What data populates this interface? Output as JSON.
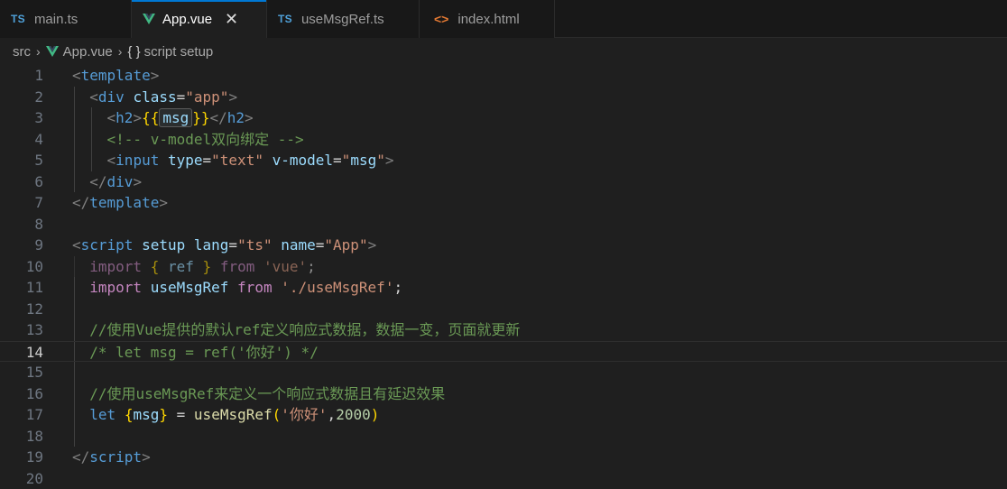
{
  "tabs": [
    {
      "badge": "TS",
      "label": "main.ts"
    },
    {
      "badge": "vue",
      "label": "App.vue",
      "close": "✕"
    },
    {
      "badge": "TS",
      "label": "useMsgRef.ts"
    },
    {
      "badge": "<>",
      "label": "index.html"
    }
  ],
  "breadcrumb": {
    "folder": "src",
    "file": "App.vue",
    "symbol_icon": "{ }",
    "symbol": "script setup"
  },
  "colors": {
    "accent": "#0078d4",
    "vue_green": "#41b883",
    "ts_blue": "#4fa1d9",
    "html_orange": "#e37933"
  },
  "editor": {
    "current_line": 14,
    "lines": [
      {
        "n": "1"
      },
      {
        "n": "2"
      },
      {
        "n": "3"
      },
      {
        "n": "4"
      },
      {
        "n": "5"
      },
      {
        "n": "6"
      },
      {
        "n": "7"
      },
      {
        "n": "8"
      },
      {
        "n": "9"
      },
      {
        "n": "10"
      },
      {
        "n": "11"
      },
      {
        "n": "12"
      },
      {
        "n": "13"
      },
      {
        "n": "14"
      },
      {
        "n": "15"
      },
      {
        "n": "16"
      },
      {
        "n": "17"
      },
      {
        "n": "18"
      },
      {
        "n": "19"
      },
      {
        "n": "20"
      }
    ],
    "code": {
      "l1": {
        "open": "<",
        "tag": "template",
        "close": ">"
      },
      "l2": {
        "open": "<",
        "tag": "div",
        "attr": "class",
        "eq": "=",
        "val": "\"app\"",
        "close": ">"
      },
      "l3": {
        "open": "<",
        "tag": "h2",
        "close": ">",
        "mus_open": "{{",
        "msg": "msg",
        "mus_close": "}}",
        "end_open": "</",
        "end_tag": "h2",
        "end_close": ">"
      },
      "l4": {
        "comment": "<!-- v-model双向绑定 -->"
      },
      "l5": {
        "open": "<",
        "tag": "input",
        "attr1": "type",
        "eq1": "=",
        "val1": "\"text\"",
        "attr2": "v-model",
        "eq2": "=",
        "val2": "\"",
        "val2_inner": "msg",
        "val2_end": "\"",
        "close": ">"
      },
      "l6": {
        "open": "</",
        "tag": "div",
        "close": ">"
      },
      "l7": {
        "open": "</",
        "tag": "template",
        "close": ">"
      },
      "l9": {
        "open": "<",
        "tag": "script",
        "attr1": "setup",
        "attr2": "lang",
        "eq2": "=",
        "val2": "\"ts\"",
        "attr3": "name",
        "eq3": "=",
        "val3": "\"App\"",
        "close": ">"
      },
      "l10": {
        "kw": "import",
        "lb": "{",
        "name": "ref",
        "rb": "}",
        "from": "from",
        "src": "'vue'",
        "semi": ";"
      },
      "l11": {
        "kw": "import",
        "name": "useMsgRef",
        "from": "from",
        "src": "'./useMsgRef'",
        "semi": ";"
      },
      "l13": {
        "comment": "//使用Vue提供的默认ref定义响应式数据，数据一变，页面就更新"
      },
      "l14": {
        "comment": "/* let msg = ref('你好') */"
      },
      "l16": {
        "comment": "//使用useMsgRef来定义一个响应式数据且有延迟效果"
      },
      "l17": {
        "kw": "let",
        "lb": "{",
        "name": "msg",
        "rb": "}",
        "eq": "=",
        "fn": "useMsgRef",
        "lp": "(",
        "str": "'你好'",
        "comma": ",",
        "num": "2000",
        "rp": ")"
      },
      "l19": {
        "open": "</",
        "tag": "script",
        "close": ">"
      }
    }
  }
}
